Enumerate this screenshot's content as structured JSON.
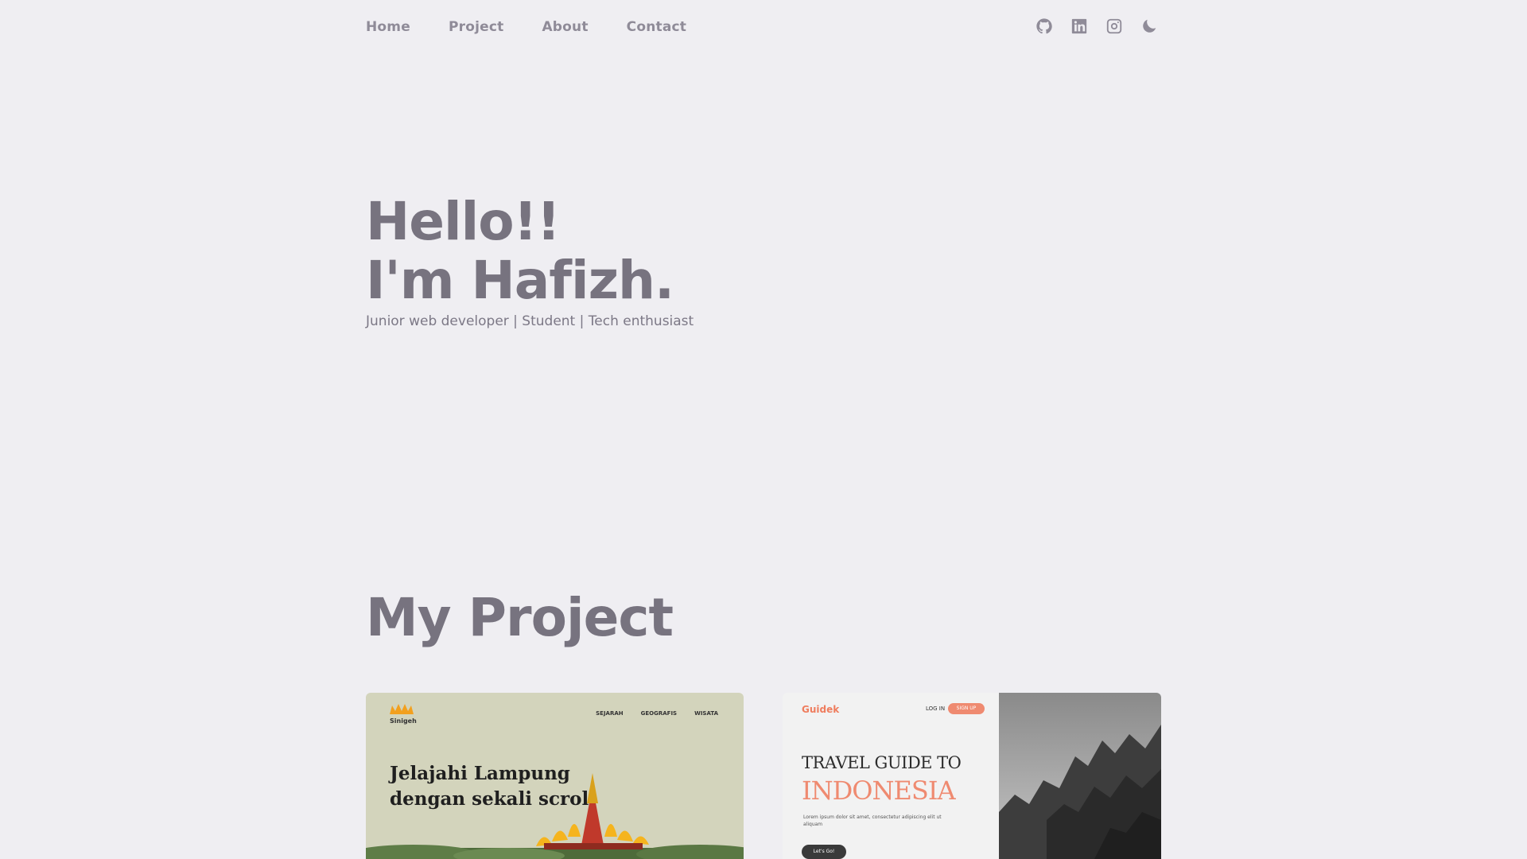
{
  "nav": {
    "links": [
      "Home",
      "Project",
      "About",
      "Contact"
    ]
  },
  "icons": [
    "github-icon",
    "linkedin-icon",
    "instagram-icon",
    "moon-icon"
  ],
  "hero": {
    "line1": "Hello!!",
    "line2": "I'm Hafizh.",
    "subtitle": "Junior web developer | Student | Tech enthusiast"
  },
  "projects": {
    "title": "My Project",
    "card1": {
      "brand": "Sinigeh",
      "menu": [
        "SEJARAH",
        "GEOGRAFIS",
        "WISATA"
      ],
      "headline_1": "Jelajahi Lampung",
      "headline_2": "dengan sekali scroll"
    },
    "card2": {
      "brand": "Guidek",
      "login": "LOG IN",
      "signup": "SIGN UP",
      "title_1": "TRAVEL GUIDE TO",
      "title_2": "INDONESIA",
      "lorem": "Lorem ipsum dolor sit amet, consectetur adipiscing elit ut aliquam",
      "cta": "Let's Go!"
    }
  },
  "colors": {
    "background": "#efeef2",
    "text": "#77737f",
    "accent": "#ef8a70"
  }
}
